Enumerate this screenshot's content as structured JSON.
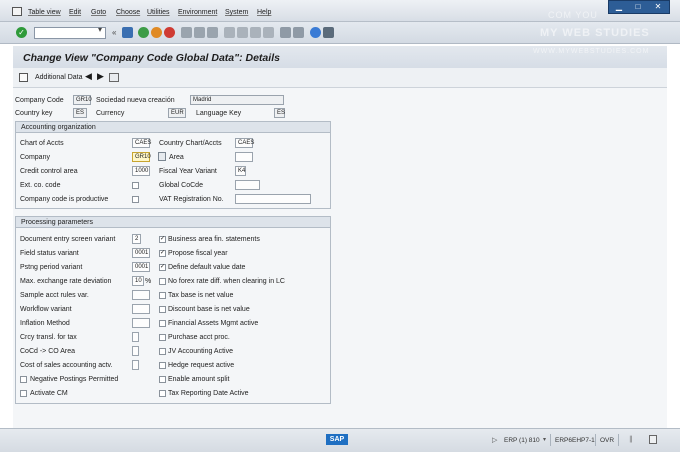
{
  "menu": {
    "items": [
      "Table view",
      "Edit",
      "Goto",
      "Choose",
      "Utilities",
      "Environment",
      "System",
      "Help"
    ]
  },
  "watermark": {
    "line1": "COM YOU",
    "line2": "MY WEB STUDIES",
    "line3": "WWW.MYWEBSTUDIES.COM"
  },
  "page": {
    "title": "Change View \"Company Code Global Data\": Details"
  },
  "app_toolbar": {
    "additional_data_label": "Additional Data"
  },
  "header": {
    "company_code_label": "Company Code",
    "company_code_value": "GR10",
    "company_name": "Sociedad nueva creación",
    "city": "Madrid",
    "country_key_label": "Country key",
    "country_key_value": "ES",
    "currency_label": "Currency",
    "currency_value": "EUR",
    "language_key_label": "Language Key",
    "language_key_value": "ES"
  },
  "accounting_org": {
    "title": "Accounting organization",
    "chart_of_accts_label": "Chart of Accts",
    "chart_of_accts_value": "CAES",
    "country_chart_label": "Country Chart/Accts",
    "country_chart_value": "CAES",
    "company_label": "Company",
    "company_value": "GR10",
    "area_label": "Area",
    "credit_control_label": "Credit control area",
    "credit_control_value": "1000",
    "fiscal_year_label": "Fiscal Year Variant",
    "fiscal_year_value": "K4",
    "ext_co_code_label": "Ext. co. code",
    "global_cocode_label": "Global CoCde",
    "company_productive_label": "Company code is productive",
    "vat_reg_label": "VAT Registration No."
  },
  "processing": {
    "title": "Processing parameters",
    "left": [
      {
        "label": "Document entry screen variant",
        "value": "2"
      },
      {
        "label": "Field status variant",
        "value": "0001"
      },
      {
        "label": "Pstng period variant",
        "value": "0001"
      },
      {
        "label": "Max. exchange rate deviation",
        "value": "10",
        "unit": "%"
      },
      {
        "label": "Sample acct rules var.",
        "value": ""
      },
      {
        "label": "Workflow variant",
        "value": ""
      },
      {
        "label": "Inflation Method",
        "value": ""
      },
      {
        "label": "Crcy transl. for tax",
        "value": ""
      },
      {
        "label": "CoCd -> CO Area",
        "value": ""
      },
      {
        "label": "Cost of sales accounting actv.",
        "value": ""
      }
    ],
    "left_checks": [
      {
        "label": "Negative Postings Permitted",
        "checked": false
      },
      {
        "label": "Activate CM",
        "checked": false
      }
    ],
    "right_checks": [
      {
        "label": "Business area fin. statements",
        "checked": true
      },
      {
        "label": "Propose fiscal year",
        "checked": true
      },
      {
        "label": "Define default value date",
        "checked": true
      },
      {
        "label": "No forex rate diff. when clearing in LC",
        "checked": false
      },
      {
        "label": "Tax base is net value",
        "checked": false
      },
      {
        "label": "Discount base is net value",
        "checked": false
      },
      {
        "label": "Financial Assets Mgmt active",
        "checked": false
      },
      {
        "label": "Purchase acct proc.",
        "checked": false
      },
      {
        "label": "JV Accounting Active",
        "checked": false
      },
      {
        "label": "Hedge request active",
        "checked": false
      },
      {
        "label": "Enable amount split",
        "checked": false
      },
      {
        "label": "Tax Reporting Date Active",
        "checked": false
      }
    ]
  },
  "status": {
    "system": "ERP (1) 810",
    "server": "ERP6EHP7-1",
    "mode": "OVR"
  }
}
